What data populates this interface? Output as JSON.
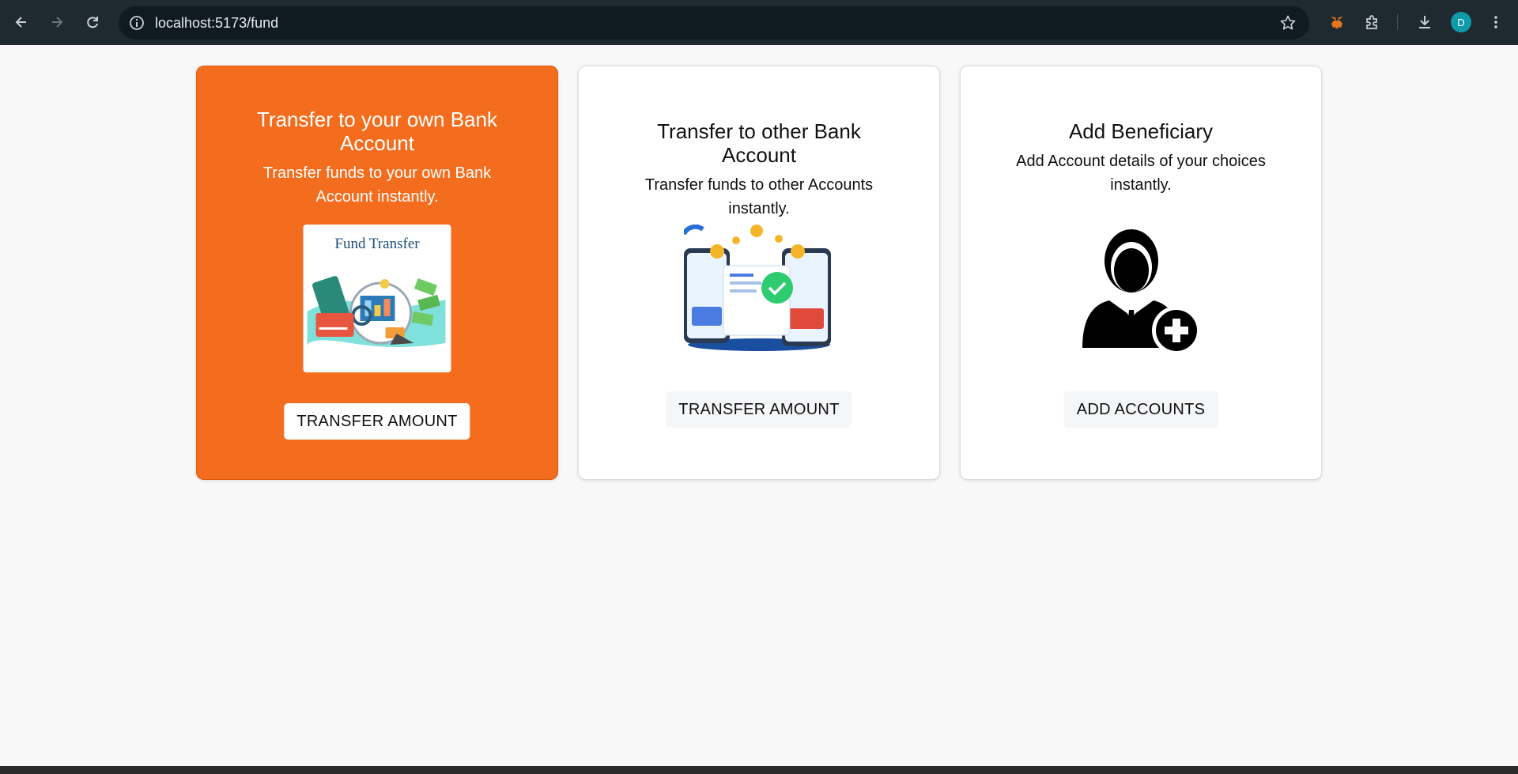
{
  "browser": {
    "url": "localhost:5173/fund",
    "profile_initial": "D",
    "icons": [
      "back-icon",
      "forward-icon",
      "reload-icon",
      "info-icon",
      "star-icon",
      "metamask-icon",
      "extensions-icon",
      "download-icon",
      "menu-icon"
    ]
  },
  "cards": [
    {
      "title": "Transfer to your own Bank Account",
      "description": "Transfer funds to your own Bank Account instantly.",
      "image_caption": "Fund Transfer",
      "button": "TRANSFER AMOUNT"
    },
    {
      "title": "Transfer to other Bank Account",
      "description": "Transfer funds to other Accounts instantly.",
      "button": "TRANSFER AMOUNT"
    },
    {
      "title": "Add Beneficiary",
      "description": "Add Account details of your choices instantly.",
      "button": "ADD ACCOUNTS"
    }
  ],
  "colors": {
    "active_card": "#f46d1e",
    "page_bg": "#f8f8f8",
    "chrome_bg": "#1f2a30"
  }
}
